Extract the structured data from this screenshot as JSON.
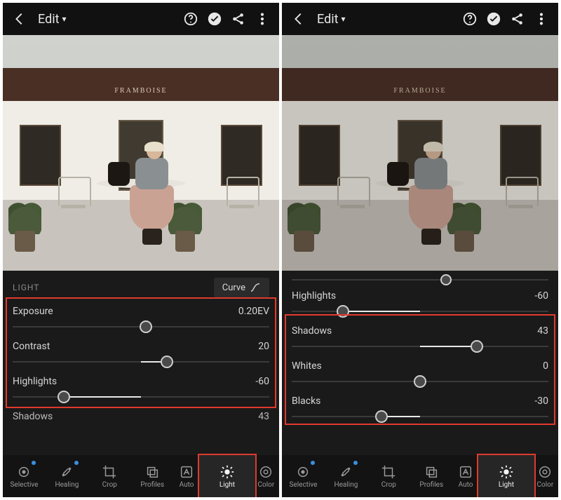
{
  "header": {
    "title": "Edit"
  },
  "left": {
    "panelTitle": "LIGHT",
    "curveLabel": "Curve",
    "sliders": {
      "exposure": {
        "label": "Exposure",
        "value": "0.20EV",
        "pct": 52
      },
      "contrast": {
        "label": "Contrast",
        "value": "20",
        "pct": 60
      },
      "highlights": {
        "label": "Highlights",
        "value": "-60",
        "pct": 20
      },
      "shadows_peek": {
        "label": "Shadows",
        "value": "43"
      }
    }
  },
  "right": {
    "sliders": {
      "peek_top_pct": 60,
      "highlights": {
        "label": "Highlights",
        "value": "-60",
        "pct": 20
      },
      "shadows": {
        "label": "Shadows",
        "value": "43",
        "pct": 72
      },
      "whites": {
        "label": "Whites",
        "value": "0",
        "pct": 50
      },
      "blacks": {
        "label": "Blacks",
        "value": "-30",
        "pct": 35
      }
    }
  },
  "tools": {
    "selective": "Selective",
    "healing": "Healing",
    "crop": "Crop",
    "profiles": "Profiles",
    "auto": "Auto",
    "light": "Light",
    "color": "Color"
  },
  "photo": {
    "sign": "FRAMBOISE"
  }
}
